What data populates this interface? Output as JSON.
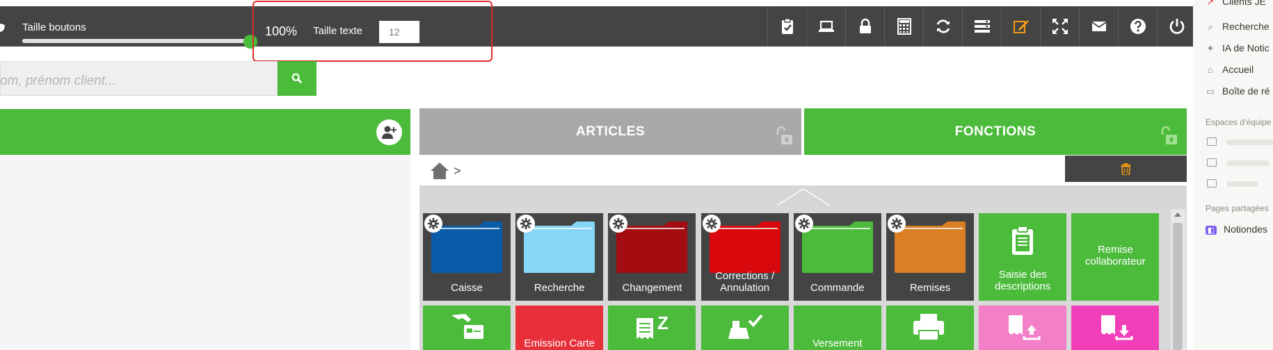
{
  "toolbar": {
    "size_label": "Taille boutons",
    "size_percent": "100%",
    "slider_value": 1.0,
    "text_size_label": "Taille texte",
    "text_size_placeholder": "12",
    "icons": [
      "clipboard-check-icon",
      "laptop-icon",
      "lock-icon",
      "calculator-icon",
      "sync-icon",
      "server-icon",
      "edit-icon",
      "expand-icon",
      "envelope-icon",
      "question-icon",
      "power-icon"
    ]
  },
  "search": {
    "placeholder": "om, prénom client..."
  },
  "tabs": {
    "articles": "ARTICLES",
    "fonctions": "FONCTIONS"
  },
  "breadcrumb": {
    "separator": ">"
  },
  "tiles_row1": [
    {
      "label": "Caisse",
      "color": "#444444",
      "folder": "#0a5ca8"
    },
    {
      "label": "Recherche",
      "color": "#444444",
      "folder": "#86d6f7"
    },
    {
      "label": "Changement",
      "color": "#444444",
      "folder": "#a30c10"
    },
    {
      "label": "Corrections / Annulation",
      "color": "#444444",
      "folder": "#d9080c"
    },
    {
      "label": "Commande",
      "color": "#444444",
      "folder": "#4cbb3c"
    },
    {
      "label": "Remises",
      "color": "#444444",
      "folder": "#da7f23"
    },
    {
      "label": "Saisie des descriptions",
      "color": "#4cbb3c"
    },
    {
      "label": "Remise collaborateur",
      "color": "#4cbb3c"
    }
  ],
  "tiles_row2": [
    {
      "label": "",
      "color": "#4cbb3c"
    },
    {
      "label": "Emission Carte",
      "color": "#e8303a"
    },
    {
      "label": "",
      "color": "#4cbb3c"
    },
    {
      "label": "",
      "color": "#4cbb3c"
    },
    {
      "label": "Versement",
      "color": "#4cbb3c"
    },
    {
      "label": "",
      "color": "#4cbb3c"
    },
    {
      "label": "",
      "color": "#f27fc8"
    },
    {
      "label": "",
      "color": "#f03fb9"
    }
  ],
  "notion": {
    "top_item": "Clients JE",
    "items": [
      "Recherche",
      "IA de Notic",
      "Accueil",
      "Boîte de ré"
    ],
    "section_teams": "Espaces d'équipe",
    "section_shared": "Pages partagées",
    "shared_item": "Notiondes"
  },
  "colors": {
    "accent_green": "#4cbb3c",
    "toolbar": "#444444",
    "highlight": "#e02b2b",
    "orange": "#f39c12"
  }
}
